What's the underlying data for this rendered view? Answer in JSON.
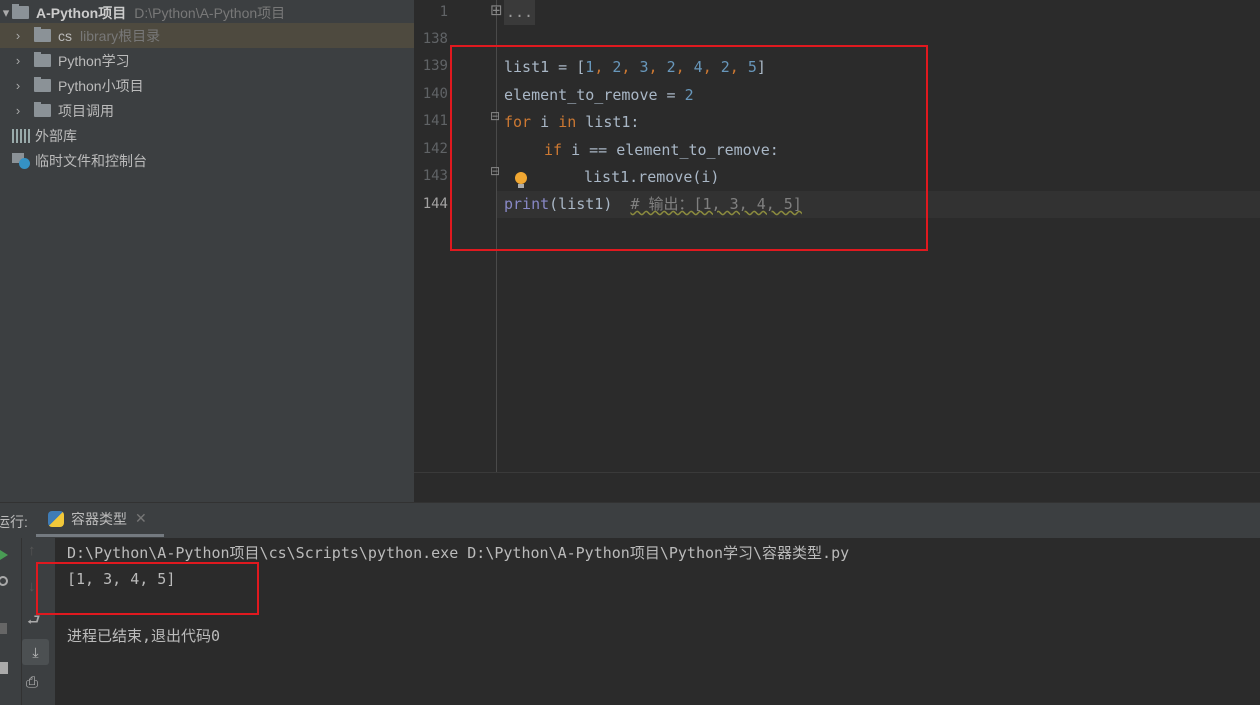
{
  "project_tree": {
    "root": {
      "name": "A-Python项目",
      "path": "D:\\Python\\A-Python项目"
    },
    "items": [
      {
        "name": "cs",
        "hint": "library根目录"
      },
      {
        "name": "Python学习"
      },
      {
        "name": "Python小项目"
      },
      {
        "name": "项目调用"
      }
    ],
    "external_libs": "外部库",
    "scratches": "临时文件和控制台"
  },
  "editor": {
    "line_numbers": [
      "1",
      "138",
      "139",
      "140",
      "141",
      "142",
      "143",
      "144"
    ],
    "folded": "...",
    "code": {
      "l139_a": "list1 = [",
      "l139_nums": [
        "1",
        "2",
        "3",
        "2",
        "4",
        "2",
        "5"
      ],
      "l139_b": "]",
      "l140_a": "element_to_remove = ",
      "l140_num": "2",
      "l141_for": "for",
      "l141_a": " i ",
      "l141_in": "in",
      "l141_b": " list1:",
      "l142_if": "if",
      "l142_a": " i == element_to_remove:",
      "l143": "list1.remove(i)",
      "l144_print": "print",
      "l144_a": "(list1)  ",
      "l144_comment": "# 输出：[1, 3, 4, 5]"
    }
  },
  "run": {
    "label": "运行:",
    "tab": "容器类型",
    "output": [
      "D:\\Python\\A-Python项目\\cs\\Scripts\\python.exe D:\\Python\\A-Python项目\\Python学习\\容器类型.py",
      "[1, 3, 4, 5]",
      "进程已结束,退出代码0"
    ]
  },
  "colors": {
    "highlight_box": "#e0191f",
    "keyword": "#cc7832",
    "number": "#6897bb"
  }
}
